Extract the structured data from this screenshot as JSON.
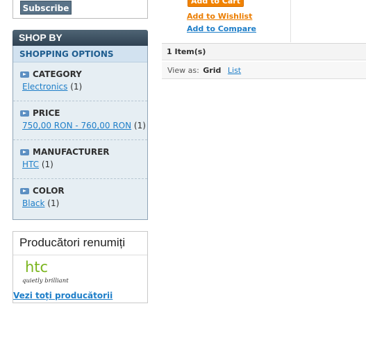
{
  "newsletter": {
    "subscribe_label": "Subscribe"
  },
  "shop_by": {
    "title": "SHOP BY",
    "subtitle": "SHOPPING OPTIONS",
    "filters": [
      {
        "name": "CATEGORY",
        "value": "Electronics",
        "count": "(1)"
      },
      {
        "name": "PRICE",
        "value": "750,00 RON - 760,00 RON",
        "count": "(1)"
      },
      {
        "name": "MANUFACTURER",
        "value": "HTC",
        "count": "(1)"
      },
      {
        "name": "COLOR",
        "value": "Black",
        "count": "(1)"
      }
    ]
  },
  "brands": {
    "title": "Producători renumiți",
    "logo_main": "htc",
    "logo_tagline": "quietly brilliant",
    "view_all": "Vezi toți producătorii"
  },
  "product": {
    "add_to_cart": "Add to Cart",
    "add_to_wishlist": "Add to Wishlist",
    "add_to_compare": "Add to Compare"
  },
  "toolbar": {
    "items_count": "1 Item(s)",
    "view_as_label": "View as:",
    "view_grid": "Grid",
    "view_list": "List"
  },
  "colors": {
    "accent": "#f18200",
    "link": "#1e7ec8",
    "header_dark": "#2f4253",
    "logo_green": "#7ab51d"
  }
}
